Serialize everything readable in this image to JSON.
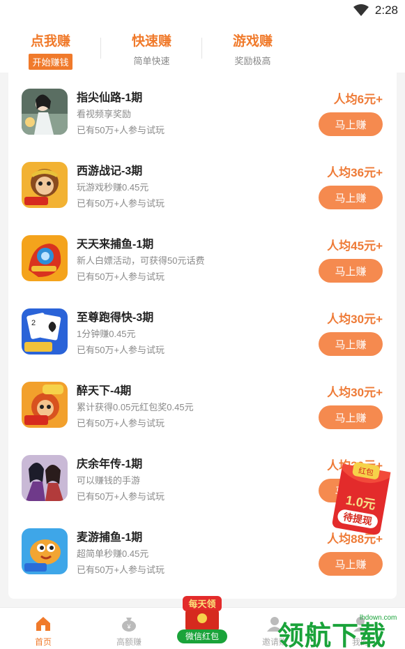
{
  "status_bar": {
    "time": "2:28"
  },
  "top_tabs": [
    {
      "title": "点我赚",
      "subtitle": "开始赚钱",
      "active": true
    },
    {
      "title": "快速赚",
      "subtitle": "简单快速",
      "active": false
    },
    {
      "title": "游戏赚",
      "subtitle": "奖励极高",
      "active": false
    }
  ],
  "items": [
    {
      "title": "指尖仙路-1期",
      "desc": "看视频享奖励",
      "count": "已有50万+人参与试玩",
      "reward": "人均6元+",
      "button": "马上赚",
      "icon": "xianlu-game-icon"
    },
    {
      "title": "西游战记-3期",
      "desc": "玩游戏秒赚0.45元",
      "count": "已有50万+人参与试玩",
      "reward": "人均36元+",
      "button": "马上赚",
      "icon": "xiyou-game-icon"
    },
    {
      "title": "天天来捕鱼-1期",
      "desc": "新人白嫖活动，可获得50元话费",
      "count": "已有50万+人参与试玩",
      "reward": "人均45元+",
      "button": "马上赚",
      "icon": "buyu-game-icon"
    },
    {
      "title": "至尊跑得快-3期",
      "desc": "1分钟赚0.45元",
      "count": "已有50万+人参与试玩",
      "reward": "人均30元+",
      "button": "马上赚",
      "icon": "poker-game-icon"
    },
    {
      "title": "醉天下-4期",
      "desc": "累计获得0.05元红包奖0.45元",
      "count": "已有50万+人参与试玩",
      "reward": "人均30元+",
      "button": "马上赚",
      "icon": "zuitianxia-game-icon"
    },
    {
      "title": "庆余年传-1期",
      "desc": "可以赚钱的手游",
      "count": "已有50万+人参与试玩",
      "reward": "人均30元+",
      "button": "马上赚",
      "icon": "qingyunian-game-icon"
    },
    {
      "title": "麦游捕鱼-1期",
      "desc": "超简单秒赚0.45元",
      "count": "已有50万+人参与试玩",
      "reward": "人均88元+",
      "button": "马上赚",
      "icon": "maiyou-game-icon"
    }
  ],
  "float_packet": {
    "top_text": "红包",
    "amount": "1.0元",
    "label": "待提现"
  },
  "bottom_nav": [
    {
      "label": "首页",
      "icon": "home-icon",
      "active": true
    },
    {
      "label": "高额赚",
      "icon": "money-bag-icon",
      "active": false
    },
    {
      "label": "邀请赚",
      "icon": "user-icon",
      "active": false
    },
    {
      "label": "我的",
      "icon": "profile-icon",
      "active": false
    }
  ],
  "center_packet": {
    "top": "每天领",
    "bottom": "微信红包"
  },
  "watermark": {
    "text": "领航下载",
    "url": "lhdown.com"
  }
}
